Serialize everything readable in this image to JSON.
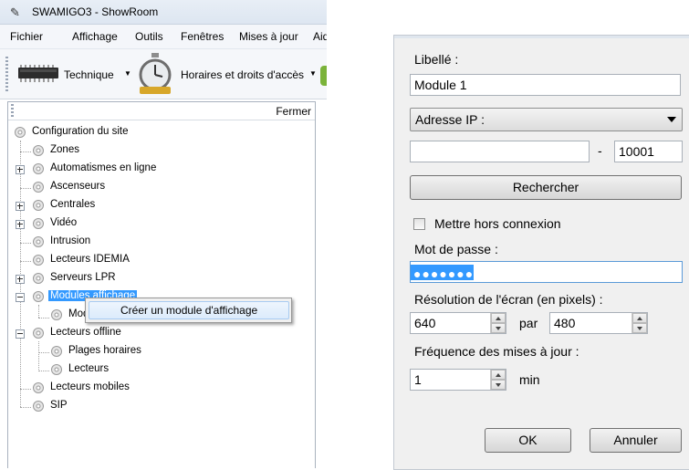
{
  "window": {
    "title": "SWAMIGO3 - ShowRoom"
  },
  "menu": [
    "Fichier",
    "Affichage",
    "Outils",
    "Fenêtres",
    "Mises à jour",
    "Aid"
  ],
  "toolbar": {
    "technique": "Technique",
    "horaires": "Horaires et droits d'accès"
  },
  "panel": {
    "close_label": "Fermer"
  },
  "tree": {
    "root": "Configuration du site",
    "zones": "Zones",
    "automatismes": "Automatismes en ligne",
    "ascenseurs": "Ascenseurs",
    "centrales": "Centrales",
    "video": "Vidéo",
    "intrusion": "Intrusion",
    "idemia": "Lecteurs IDEMIA",
    "lpr": "Serveurs LPR",
    "modules": "Modules affichage",
    "module_child": "Mod",
    "offline": "Lecteurs offline",
    "plages": "Plages horaires",
    "lecteurs": "Lecteurs",
    "mobiles": "Lecteurs mobiles",
    "sip": "SIP"
  },
  "context_menu": {
    "item": "Créer un module d'affichage"
  },
  "dialog": {
    "libelle_label": "Libellé :",
    "libelle_value": "Module 1",
    "address_type": "Adresse IP :",
    "ip_value": "",
    "separator": "-",
    "port_value": "10001",
    "search_button": "Rechercher",
    "offline_label": "Mettre hors connexion",
    "offline_checked": false,
    "password_label": "Mot de passe :",
    "password_mask": "●●●●●●●",
    "resolution_label": "Résolution de l'écran (en pixels) :",
    "width": "640",
    "par": "par",
    "height": "480",
    "frequency_label": "Fréquence des mises à jour :",
    "frequency_value": "1",
    "unit": "min",
    "ok": "OK",
    "cancel": "Annuler"
  }
}
